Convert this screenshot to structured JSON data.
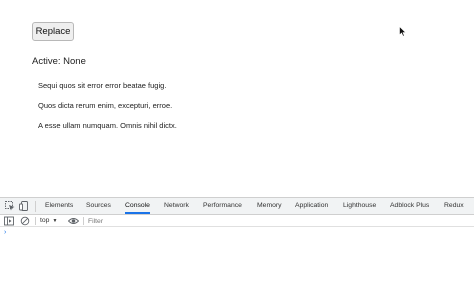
{
  "page": {
    "replace_button": "Replace",
    "active_label": "Active: None",
    "paragraphs": [
      "Sequi quos sit error error beatae fugig.",
      "Quos dicta rerum enim, excepturi, erroe.",
      "A esse ullam numquam. Omnis nihil dictx."
    ]
  },
  "devtools": {
    "tabs": [
      {
        "label": "Elements",
        "active": false
      },
      {
        "label": "Sources",
        "active": false
      },
      {
        "label": "Console",
        "active": true
      },
      {
        "label": "Network",
        "active": false
      },
      {
        "label": "Performance",
        "active": false
      },
      {
        "label": "Memory",
        "active": false
      },
      {
        "label": "Application",
        "active": false
      },
      {
        "label": "Lighthouse",
        "active": false
      },
      {
        "label": "Adblock Plus",
        "active": false
      },
      {
        "label": "Redux",
        "active": false
      }
    ],
    "context": "top",
    "filter_placeholder": "Filter",
    "prompt_symbol": "›",
    "accent_color": "#1a73e8"
  }
}
